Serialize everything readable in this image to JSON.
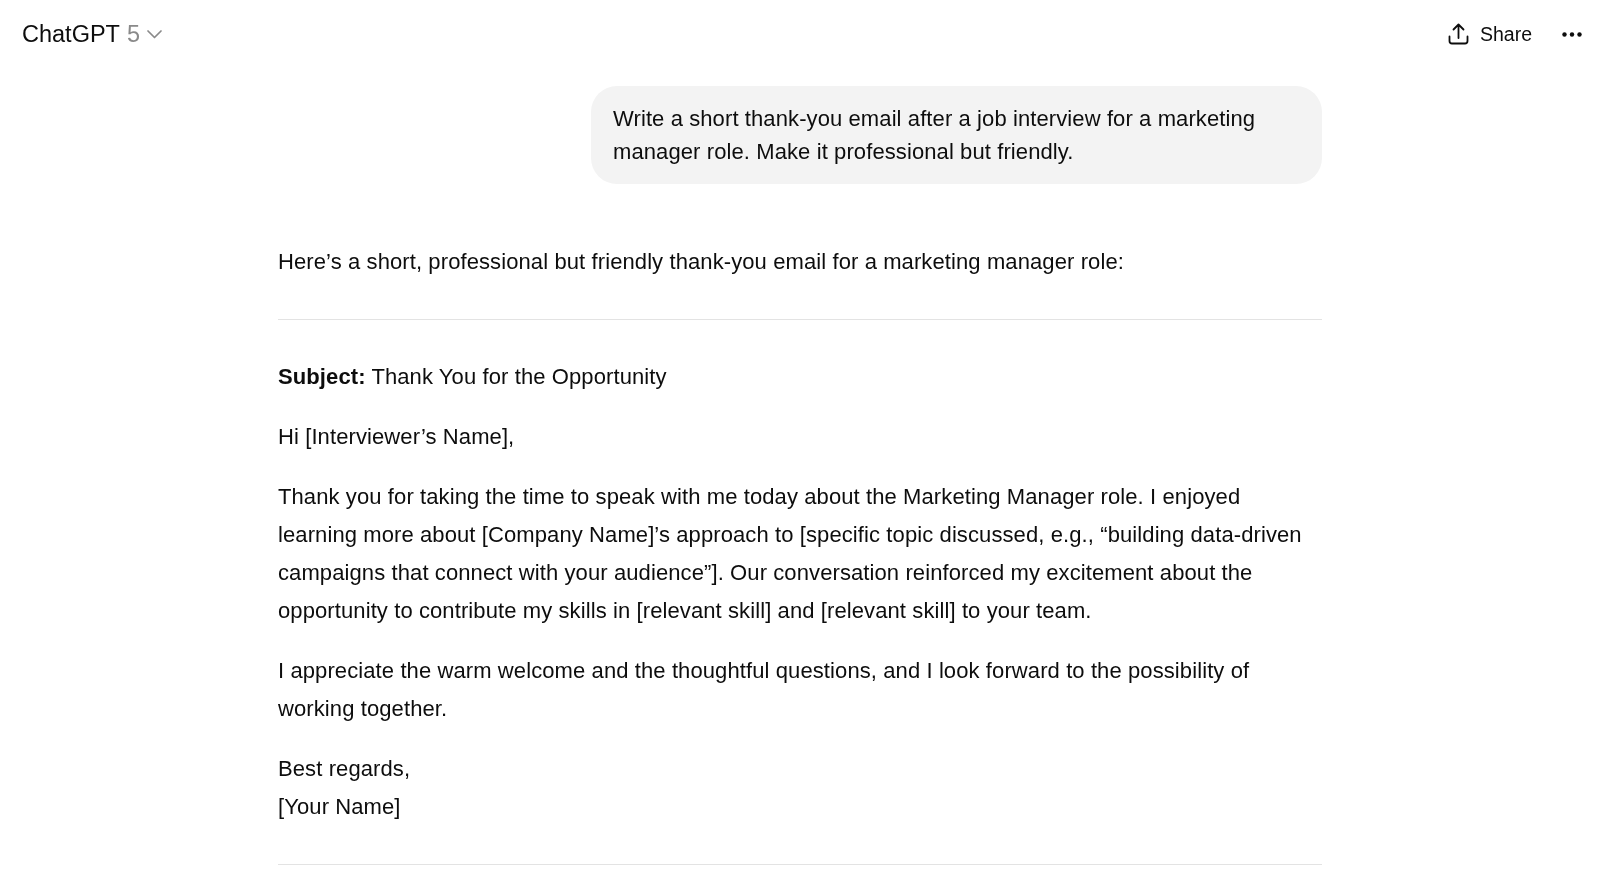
{
  "header": {
    "title": "ChatGPT",
    "model": "5",
    "share_label": "Share"
  },
  "conversation": [
    {
      "kind": "user",
      "text": "Write a short thank-you email after a job interview for a marketing manager role. Make it professional but friendly."
    },
    {
      "kind": "assistant",
      "blocks": [
        {
          "kind": "paragraph",
          "text": "Here’s a short, professional but friendly thank-you email for a marketing manager role:"
        },
        {
          "kind": "rule"
        },
        {
          "kind": "paragraph",
          "text": "**Subject:** Thank You for the Opportunity"
        },
        {
          "kind": "paragraph",
          "text": "Hi [Interviewer’s Name],"
        },
        {
          "kind": "paragraph",
          "text": "Thank you for taking the time to speak with me today about the Marketing Manager role. I enjoyed learning more about [Company Name]’s approach to [specific topic discussed, e.g., “building data-driven campaigns that connect with your audience”]. Our conversation reinforced my excitement about the opportunity to contribute my skills in [relevant skill] and [relevant skill] to your team."
        },
        {
          "kind": "paragraph",
          "text": "I appreciate the warm welcome and the thoughtful questions, and I look forward to the possibility of working together."
        },
        {
          "kind": "lines",
          "lines": [
            "Best regards,",
            "[Your Name]"
          ]
        },
        {
          "kind": "rule"
        }
      ]
    }
  ]
}
